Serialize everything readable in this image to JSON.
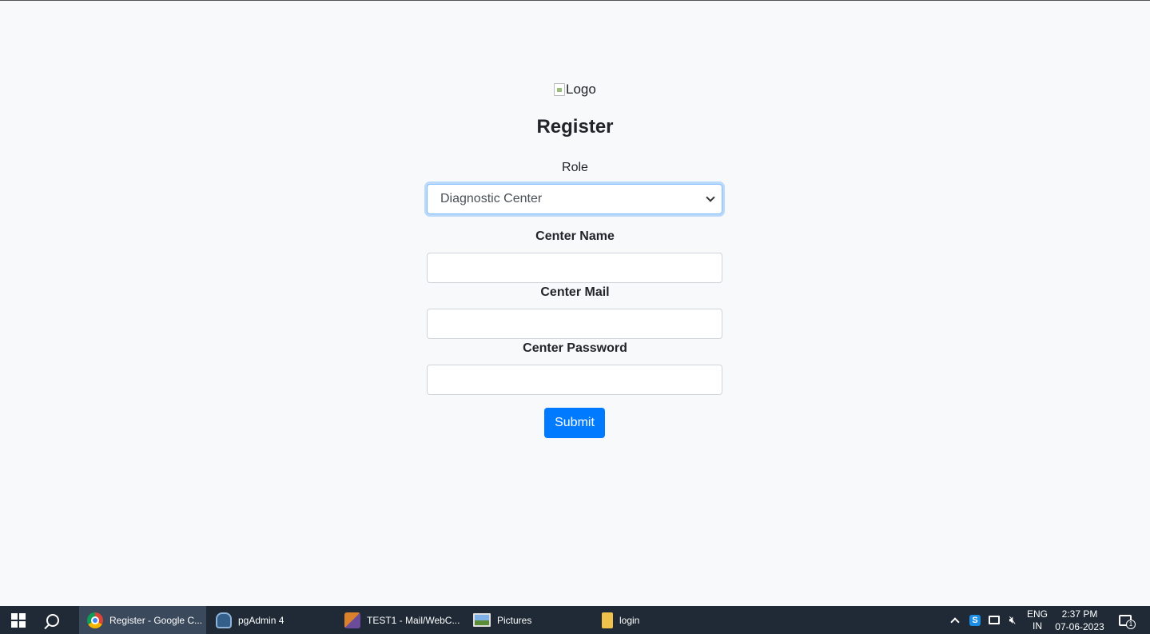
{
  "page": {
    "logo_alt": "Logo",
    "title": "Register",
    "role_label": "Role",
    "role_selected": "Diagnostic Center",
    "fields": [
      {
        "label": "Center Name",
        "value": ""
      },
      {
        "label": "Center Mail",
        "value": ""
      },
      {
        "label": "Center Password",
        "value": ""
      }
    ],
    "submit_label": "Submit",
    "accent_color": "#007bff"
  },
  "taskbar": {
    "apps": [
      {
        "label": "Register - Google C...",
        "icon": "chrome-icon",
        "active": true
      },
      {
        "label": "pgAdmin 4",
        "icon": "pgadmin-icon",
        "active": false
      },
      {
        "label": "TEST1 - Mail/WebC...",
        "icon": "mail-app-icon",
        "active": false
      },
      {
        "label": "Pictures",
        "icon": "pictures-icon",
        "active": false
      },
      {
        "label": "login",
        "icon": "folder-icon",
        "active": false
      }
    ],
    "tray": {
      "lang_top": "ENG",
      "lang_bottom": "IN",
      "time": "2:37 PM",
      "date": "07-06-2023",
      "s_icon_letter": "S",
      "notification_count": "1"
    }
  }
}
